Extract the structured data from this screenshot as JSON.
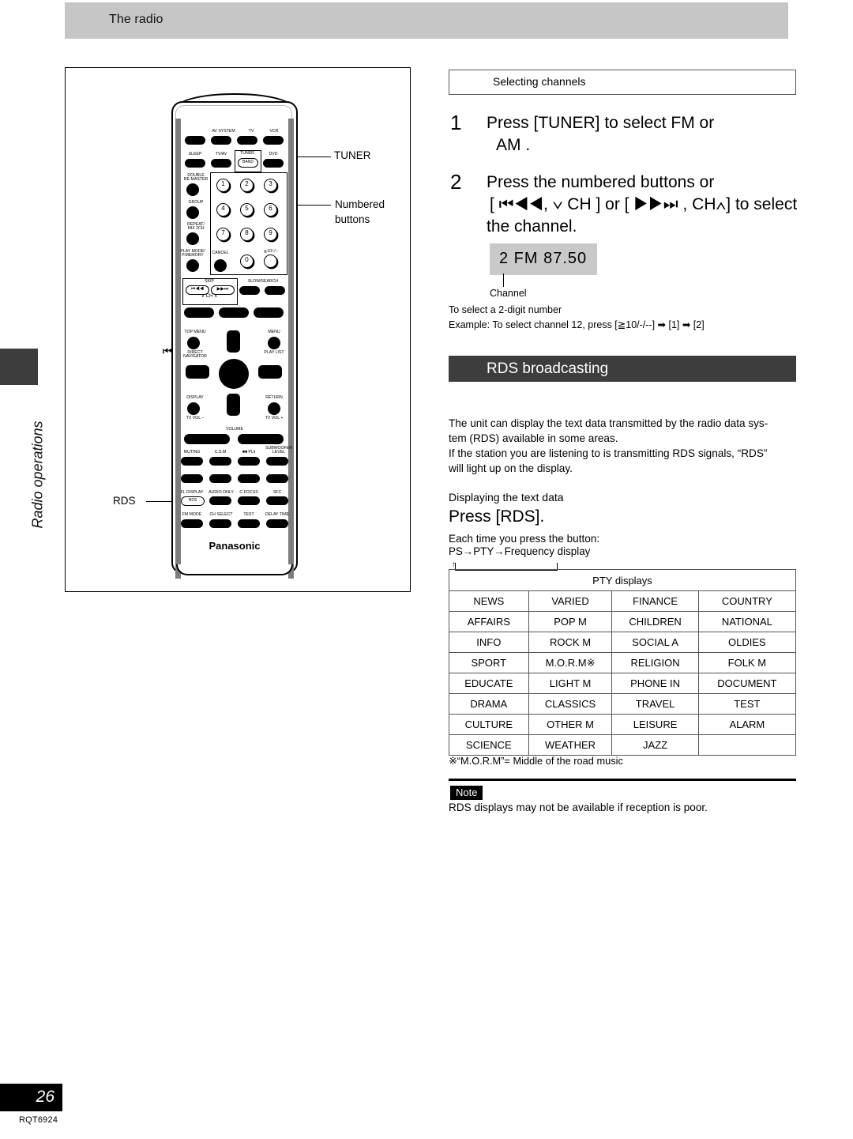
{
  "header": {
    "title": "The radio"
  },
  "side": {
    "tab_label": "Radio operations"
  },
  "footer": {
    "page_number": "26",
    "doc_code": "RQT6924"
  },
  "illustration": {
    "brand": "Panasonic",
    "callouts": {
      "tuner": "TUNER",
      "numbered_line1": "Numbered",
      "numbered_line2": "buttons",
      "skip_line1": "SKIP",
      "skip_line2": "⏮◀◀ , ▶▶⏭",
      "skip_line3": "∨ CH ∧",
      "rds": "RDS"
    },
    "buttons": {
      "av_system": "AV SYSTEM",
      "tv": "TV",
      "vcr": "VCR",
      "sleep": "SLEEP",
      "tv_av": "TV/AV",
      "tuner": "TUNER",
      "band": "BAND",
      "dvd": "DVD",
      "double_remaster_l1": "DOUBLE",
      "double_remaster_l2": "RE-MASTER",
      "group": "GROUP",
      "repeat_l1": "REPEAT/",
      "repeat_l2": "MIX 2CH",
      "playmode_l1": "PLAY MODE/",
      "playmode_l2": "P.MEMORY",
      "cancel": "CANCEL",
      "over10": "≧10/-/--",
      "skip": "SKIP",
      "skip_prev": "⏮◀◀",
      "skip_next": "▶▶⏭",
      "ch_down_up": "∨  CH  ∧",
      "slow_search": "SLOW/SEARCH",
      "top_menu": "TOP MENU",
      "menu": "MENU",
      "direct_l1": "DIRECT",
      "direct_l2": "NAVIGATOR",
      "play_list": "PLAY LIST",
      "display": "DISPLAY",
      "return": "RETURN",
      "tv_vol_minus": "TV VOL −",
      "tv_vol_plus": "TV VOL +",
      "volume": "VOLUME",
      "muting": "MUTING",
      "csm": "C.S.M",
      "plii": "■■ PLⅡ",
      "subwoofer_l1": "SUBWOOFER",
      "subwoofer_l2": "LEVEL",
      "fl_display": "FL DISPLAY",
      "rds": "RDS",
      "audio_only": "AUDIO ONLY",
      "c_focus": "C.FOCUS",
      "sfc": "SFC",
      "fm_mode": "FM MODE",
      "ch_select": "CH SELECT",
      "test": "TEST",
      "delay_time": "DELAY TIME"
    },
    "numbers": [
      "1",
      "2",
      "3",
      "4",
      "5",
      "6",
      "7",
      "8",
      "9",
      "0"
    ]
  },
  "selecting_channels": {
    "box_title": "Selecting channels",
    "step1_num": "1",
    "step1_line1": "Press  [TUNER]  to  select     FM   or",
    "step1_line2": "AM  .",
    "step2_num": "2",
    "step2_line1": "Press the numbered buttons or",
    "step2_line2": "[ ⏮◀◀,  ∨ CH ] or [  ▶▶⏭ , CH∧] to select",
    "step2_line3": "the channel.",
    "display_value": "2  FM  87.50",
    "display_caption": "Channel",
    "note_2digit": "To select a 2-digit number",
    "note_example": "Example:  To select channel 12, press [≧10/-/--] ➡ [1] ➡ [2]"
  },
  "rds": {
    "section_title": "RDS broadcasting",
    "para1_line1": "The unit can display the text data transmitted by the radio data sys-",
    "para1_line2": "tem (RDS) available in some areas.",
    "para1_line3": "If the station you are listening to is transmitting RDS signals, “RDS”",
    "para1_line4": "will light up on the display.",
    "sub_heading": "Displaying the text data",
    "press_rds": "Press [RDS].",
    "each_time": "Each time you press the button:",
    "cycle": "PS→PTY→Frequency display",
    "cycle_arrow": "↑",
    "table_header": "PTY displays",
    "table_rows": [
      [
        "NEWS",
        "VARIED",
        "FINANCE",
        "COUNTRY"
      ],
      [
        "AFFAIRS",
        "POP M",
        "CHILDREN",
        "NATIONAL"
      ],
      [
        "INFO",
        "ROCK M",
        "SOCIAL A",
        "OLDIES"
      ],
      [
        "SPORT",
        "M.O.R.M※",
        "RELIGION",
        "FOLK M"
      ],
      [
        "EDUCATE",
        "LIGHT M",
        "PHONE IN",
        "DOCUMENT"
      ],
      [
        "DRAMA",
        "CLASSICS",
        "TRAVEL",
        "TEST"
      ],
      [
        "CULTURE",
        "OTHER M",
        "LEISURE",
        "ALARM"
      ],
      [
        "SCIENCE",
        "WEATHER",
        "JAZZ",
        ""
      ]
    ],
    "footnote": "※“M.O.R.M”= Middle of the road music",
    "note_tag": "Note",
    "note_text": "RDS displays may not be available if reception is poor."
  }
}
